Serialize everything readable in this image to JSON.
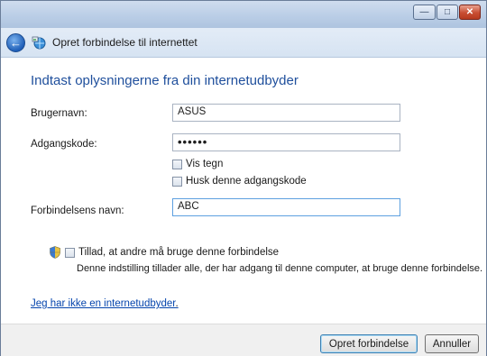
{
  "window": {
    "minimize_glyph": "—",
    "maximize_glyph": "□",
    "close_glyph": "✕"
  },
  "nav": {
    "back_glyph": "←",
    "title": "Opret forbindelse til internettet",
    "icon": "network-globe-icon"
  },
  "form": {
    "heading": "Indtast oplysningerne fra din internetudbyder",
    "username_label": "Brugernavn:",
    "username_value": "ASUS",
    "password_label": "Adgangskode:",
    "password_value": "••••••",
    "show_chars_label": "Vis tegn",
    "remember_password_label": "Husk denne adgangskode",
    "connection_name_label": "Forbindelsens navn:",
    "connection_name_value": "ABC",
    "allow_others_label": "Tillad, at andre må bruge denne forbindelse",
    "allow_others_note": "Denne indstilling tillader alle, der har adgang til denne computer, at bruge denne forbindelse.",
    "no_isp_link": "Jeg har ikke en internetudbyder",
    "no_isp_suffix": "."
  },
  "footer": {
    "connect_button": "Opret forbindelse",
    "cancel_button": "Annuller"
  },
  "colors": {
    "heading": "#1f4f9c",
    "link": "#0645ad",
    "accent_focus": "#5da0e0"
  }
}
